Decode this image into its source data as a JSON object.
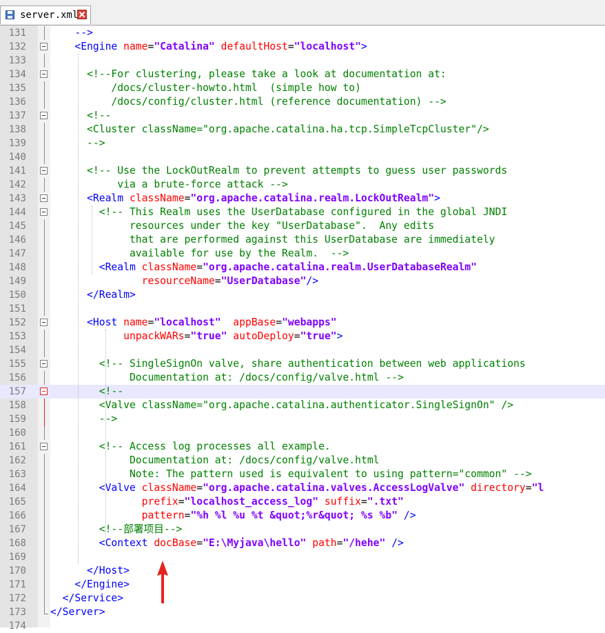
{
  "tab": {
    "filename": "server.xml",
    "save_icon": "floppy-disk-icon",
    "close_icon": "close-icon"
  },
  "lines": [
    {
      "n": "131",
      "fold": "line",
      "seg": [
        {
          "c": "t",
          "s": "    -->"
        }
      ]
    },
    {
      "n": "132",
      "fold": "box",
      "seg": [
        {
          "c": "t",
          "s": "    <Engine "
        },
        {
          "c": "a",
          "s": "name"
        },
        {
          "c": "d",
          "s": "="
        },
        {
          "c": "v",
          "s": "\"Catalina\""
        },
        {
          "c": "a",
          "s": " defaultHost"
        },
        {
          "c": "d",
          "s": "="
        },
        {
          "c": "v",
          "s": "\"localhost\""
        },
        {
          "c": "t",
          "s": ">"
        }
      ]
    },
    {
      "n": "133",
      "fold": "line",
      "seg": []
    },
    {
      "n": "134",
      "fold": "box",
      "seg": [
        {
          "c": "c",
          "s": "      <!--For clustering, please take a look at documentation at:"
        }
      ]
    },
    {
      "n": "135",
      "fold": "line",
      "seg": [
        {
          "c": "c",
          "s": "          /docs/cluster-howto.html  (simple how to)"
        }
      ]
    },
    {
      "n": "136",
      "fold": "line",
      "seg": [
        {
          "c": "c",
          "s": "          /docs/config/cluster.html (reference documentation) -->"
        }
      ]
    },
    {
      "n": "137",
      "fold": "box",
      "seg": [
        {
          "c": "c",
          "s": "      <!--"
        }
      ]
    },
    {
      "n": "138",
      "fold": "line",
      "seg": [
        {
          "c": "c",
          "s": "      <Cluster className=\"org.apache.catalina.ha.tcp.SimpleTcpCluster\"/>"
        }
      ]
    },
    {
      "n": "139",
      "fold": "line",
      "seg": [
        {
          "c": "c",
          "s": "      -->"
        }
      ]
    },
    {
      "n": "140",
      "fold": "line",
      "seg": []
    },
    {
      "n": "141",
      "fold": "box",
      "seg": [
        {
          "c": "c",
          "s": "      <!-- Use the LockOutRealm to prevent attempts to guess user passwords"
        }
      ]
    },
    {
      "n": "142",
      "fold": "line",
      "seg": [
        {
          "c": "c",
          "s": "           via a brute-force attack -->"
        }
      ]
    },
    {
      "n": "143",
      "fold": "box",
      "seg": [
        {
          "c": "t",
          "s": "      <Realm "
        },
        {
          "c": "a",
          "s": "className"
        },
        {
          "c": "d",
          "s": "="
        },
        {
          "c": "v",
          "s": "\"org.apache.catalina.realm.LockOutRealm\""
        },
        {
          "c": "t",
          "s": ">"
        }
      ]
    },
    {
      "n": "144",
      "fold": "box",
      "seg": [
        {
          "c": "c",
          "s": "        <!-- This Realm uses the UserDatabase configured in the global JNDI"
        }
      ]
    },
    {
      "n": "145",
      "fold": "line",
      "seg": [
        {
          "c": "c",
          "s": "             resources under the key \"UserDatabase\".  Any edits"
        }
      ]
    },
    {
      "n": "146",
      "fold": "line",
      "seg": [
        {
          "c": "c",
          "s": "             that are performed against this UserDatabase are immediately"
        }
      ]
    },
    {
      "n": "147",
      "fold": "line",
      "seg": [
        {
          "c": "c",
          "s": "             available for use by the Realm.  -->"
        }
      ]
    },
    {
      "n": "148",
      "fold": "line",
      "seg": [
        {
          "c": "t",
          "s": "        <Realm "
        },
        {
          "c": "a",
          "s": "className"
        },
        {
          "c": "d",
          "s": "="
        },
        {
          "c": "v",
          "s": "\"org.apache.catalina.realm.UserDatabaseRealm\""
        }
      ]
    },
    {
      "n": "149",
      "fold": "line",
      "seg": [
        {
          "c": "a",
          "s": "               resourceName"
        },
        {
          "c": "d",
          "s": "="
        },
        {
          "c": "v",
          "s": "\"UserDatabase\""
        },
        {
          "c": "t",
          "s": "/>"
        }
      ]
    },
    {
      "n": "150",
      "fold": "line",
      "seg": [
        {
          "c": "t",
          "s": "      </Realm>"
        }
      ]
    },
    {
      "n": "151",
      "fold": "line",
      "seg": []
    },
    {
      "n": "152",
      "fold": "box",
      "seg": [
        {
          "c": "t",
          "s": "      <Host "
        },
        {
          "c": "a",
          "s": "name"
        },
        {
          "c": "d",
          "s": "="
        },
        {
          "c": "v",
          "s": "\"localhost\""
        },
        {
          "c": "a",
          "s": "  appBase"
        },
        {
          "c": "d",
          "s": "="
        },
        {
          "c": "v",
          "s": "\"webapps\""
        }
      ]
    },
    {
      "n": "153",
      "fold": "line",
      "seg": [
        {
          "c": "a",
          "s": "            unpackWARs"
        },
        {
          "c": "d",
          "s": "="
        },
        {
          "c": "v",
          "s": "\"true\""
        },
        {
          "c": "a",
          "s": " autoDeploy"
        },
        {
          "c": "d",
          "s": "="
        },
        {
          "c": "v",
          "s": "\"true\""
        },
        {
          "c": "t",
          "s": ">"
        }
      ]
    },
    {
      "n": "154",
      "fold": "line",
      "seg": []
    },
    {
      "n": "155",
      "fold": "box",
      "seg": [
        {
          "c": "c",
          "s": "        <!-- SingleSignOn valve, share authentication between web applications"
        }
      ]
    },
    {
      "n": "156",
      "fold": "line",
      "seg": [
        {
          "c": "c",
          "s": "             Documentation at: /docs/config/valve.html -->"
        }
      ]
    },
    {
      "n": "157",
      "fold": "boxred",
      "hl": true,
      "seg": [
        {
          "c": "c",
          "s": "        <!--"
        }
      ]
    },
    {
      "n": "158",
      "fold": "redline",
      "seg": [
        {
          "c": "c",
          "s": "        <Valve className=\"org.apache.catalina.authenticator.SingleSignOn\" />"
        }
      ]
    },
    {
      "n": "159",
      "fold": "redline",
      "seg": [
        {
          "c": "c",
          "s": "        -->"
        }
      ]
    },
    {
      "n": "160",
      "fold": "line",
      "seg": []
    },
    {
      "n": "161",
      "fold": "box",
      "seg": [
        {
          "c": "c",
          "s": "        <!-- Access log processes all example."
        }
      ]
    },
    {
      "n": "162",
      "fold": "line",
      "seg": [
        {
          "c": "c",
          "s": "             Documentation at: /docs/config/valve.html"
        }
      ]
    },
    {
      "n": "163",
      "fold": "line",
      "seg": [
        {
          "c": "c",
          "s": "             Note: The pattern used is equivalent to using pattern=\"common\" -->"
        }
      ]
    },
    {
      "n": "164",
      "fold": "line",
      "seg": [
        {
          "c": "t",
          "s": "        <Valve "
        },
        {
          "c": "a",
          "s": "className"
        },
        {
          "c": "d",
          "s": "="
        },
        {
          "c": "v",
          "s": "\"org.apache.catalina.valves.AccessLogValve\""
        },
        {
          "c": "a",
          "s": " directory"
        },
        {
          "c": "d",
          "s": "="
        },
        {
          "c": "v",
          "s": "\"l"
        }
      ]
    },
    {
      "n": "165",
      "fold": "line",
      "seg": [
        {
          "c": "a",
          "s": "               prefix"
        },
        {
          "c": "d",
          "s": "="
        },
        {
          "c": "v",
          "s": "\"localhost_access_log\""
        },
        {
          "c": "a",
          "s": " suffix"
        },
        {
          "c": "d",
          "s": "="
        },
        {
          "c": "v",
          "s": "\".txt\""
        }
      ]
    },
    {
      "n": "166",
      "fold": "line",
      "seg": [
        {
          "c": "a",
          "s": "               pattern"
        },
        {
          "c": "d",
          "s": "="
        },
        {
          "c": "v",
          "s": "\"%h %l %u %t &quot;%r&quot; %s %b\""
        },
        {
          "c": "t",
          "s": " />"
        }
      ]
    },
    {
      "n": "167",
      "fold": "line",
      "seg": [
        {
          "c": "c",
          "s": "        <!--部署项目-->"
        }
      ]
    },
    {
      "n": "168",
      "fold": "line",
      "seg": [
        {
          "c": "t",
          "s": "        <Context "
        },
        {
          "c": "a",
          "s": "docBase"
        },
        {
          "c": "d",
          "s": "="
        },
        {
          "c": "v",
          "s": "\"E:\\Myjava\\hello\""
        },
        {
          "c": "a",
          "s": " path"
        },
        {
          "c": "d",
          "s": "="
        },
        {
          "c": "v",
          "s": "\"/hehe\""
        },
        {
          "c": "t",
          "s": " />"
        }
      ]
    },
    {
      "n": "169",
      "fold": "line",
      "seg": []
    },
    {
      "n": "170",
      "fold": "line",
      "seg": [
        {
          "c": "t",
          "s": "      </Host>"
        }
      ]
    },
    {
      "n": "171",
      "fold": "line",
      "seg": [
        {
          "c": "t",
          "s": "    </Engine>"
        }
      ]
    },
    {
      "n": "172",
      "fold": "line",
      "seg": [
        {
          "c": "t",
          "s": "  </Service>"
        }
      ]
    },
    {
      "n": "173",
      "fold": "end",
      "seg": [
        {
          "c": "t",
          "s": "</Server>"
        }
      ]
    },
    {
      "n": "174",
      "fold": "none",
      "seg": []
    }
  ],
  "colors": {
    "tag": "#0000ff",
    "attribute": "#ff0000",
    "value": "#8000ff",
    "comment": "#008000",
    "annotation_arrow": "#e8231e",
    "current_line": "#e8e8ff"
  }
}
